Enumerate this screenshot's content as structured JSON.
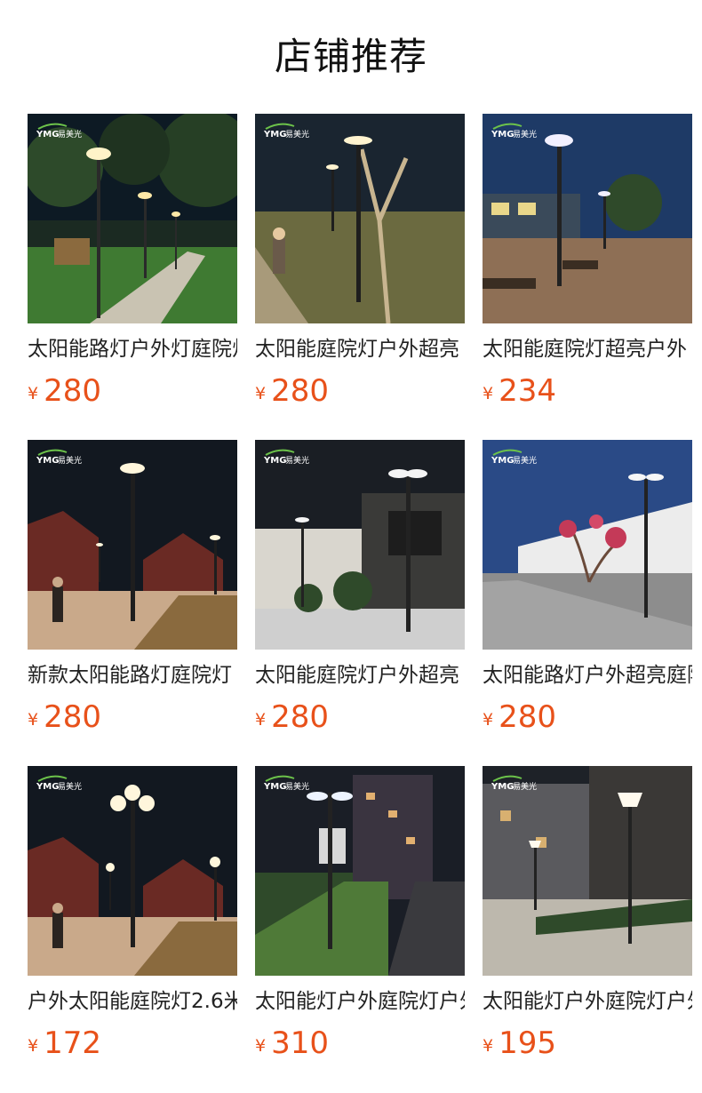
{
  "page": {
    "title": "店铺推荐"
  },
  "brand_logo": {
    "text": "YMG",
    "cn": "易美光"
  },
  "products": [
    {
      "name": "太阳能路灯户外灯庭院灯",
      "currency": "¥",
      "price": "280",
      "scene": "park-path-night"
    },
    {
      "name": "太阳能庭院灯户外超亮",
      "currency": "¥",
      "price": "280",
      "scene": "stairs-garden-night"
    },
    {
      "name": "太阳能庭院灯超亮户外",
      "currency": "¥",
      "price": "234",
      "scene": "plaza-benches-dusk"
    },
    {
      "name": "新款太阳能路灯庭院灯",
      "currency": "¥",
      "price": "280",
      "scene": "village-road-night"
    },
    {
      "name": "太阳能庭院灯户外超亮",
      "currency": "¥",
      "price": "280",
      "scene": "modern-villa-night"
    },
    {
      "name": "太阳能路灯户外超亮庭院",
      "currency": "¥",
      "price": "280",
      "scene": "white-wall-street"
    },
    {
      "name": "户外太阳能庭院灯2.6米",
      "currency": "¥",
      "price": "172",
      "scene": "village-road-night-multi"
    },
    {
      "name": "太阳能灯户外庭院灯户外",
      "currency": "¥",
      "price": "310",
      "scene": "city-road-night"
    },
    {
      "name": "太阳能灯户外庭院灯户外",
      "currency": "¥",
      "price": "195",
      "scene": "apartment-garden-dusk"
    }
  ]
}
